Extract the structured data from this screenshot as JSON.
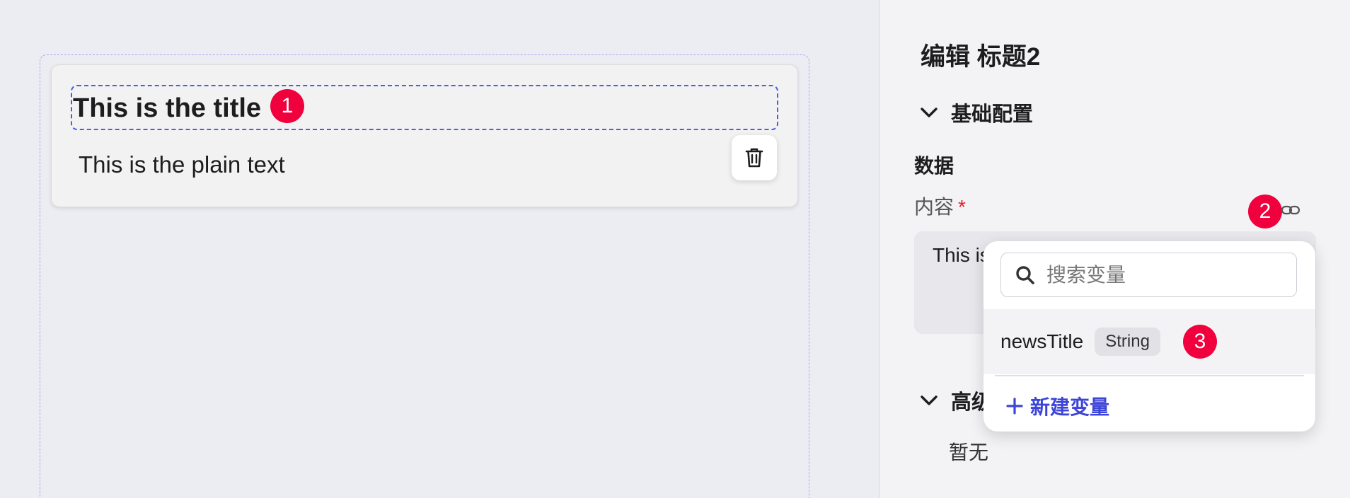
{
  "canvas": {
    "title": "This is the title",
    "plain_text": "This is the plain text",
    "delete_icon": "trash-icon"
  },
  "badges": {
    "one": "1",
    "two": "2",
    "three": "3"
  },
  "panel": {
    "title": "编辑 标题2",
    "basic_section": "基础配置",
    "data_label": "数据",
    "content_label": "内容",
    "required_mark": "*",
    "content_value": "This is",
    "advanced_section": "高级",
    "none_text": "暂无"
  },
  "popover": {
    "search_placeholder": "搜索变量",
    "variable": {
      "name": "newsTitle",
      "type": "String"
    },
    "new_variable": "新建变量"
  },
  "colors": {
    "accent": "#3d44d8",
    "badge": "#f0003c",
    "selection_border": "#4a5bf0",
    "required": "#e5202e"
  }
}
